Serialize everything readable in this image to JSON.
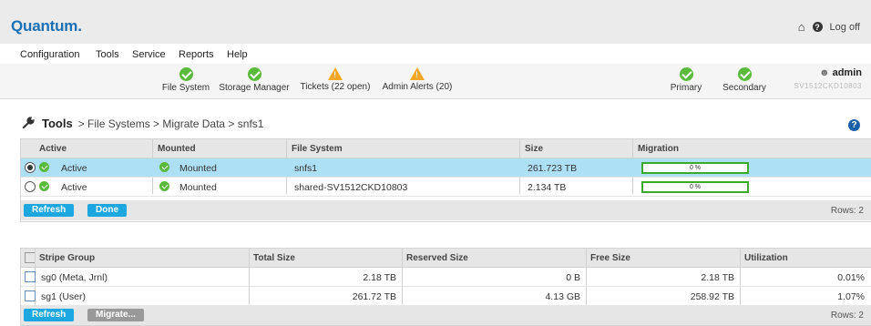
{
  "header": {
    "logo": "Quantum",
    "logo_dot": ".",
    "logoff": "Log off"
  },
  "menu": [
    "Configuration",
    "Tools",
    "Service",
    "Reports",
    "Help"
  ],
  "status": {
    "file_system": "File System",
    "storage_manager": "Storage Manager",
    "tickets": "Tickets (22 open)",
    "admin_alerts": "Admin Alerts (20)",
    "primary": "Primary",
    "secondary": "Secondary",
    "user": "admin",
    "host": "SV1512CKD10803"
  },
  "page": {
    "title": "Tools",
    "breadcrumb": "> File Systems > Migrate Data > snfs1"
  },
  "fs_table": {
    "headers": [
      "Active",
      "Mounted",
      "File System",
      "Size",
      "Migration"
    ],
    "rows": [
      {
        "active": "Active",
        "mounted": "Mounted",
        "fs": "snfs1",
        "size": "261.723 TB",
        "migration": "0 %",
        "progress": 0,
        "selected": true
      },
      {
        "active": "Active",
        "mounted": "Mounted",
        "fs": "shared-SV1512CKD10803",
        "size": "2.134 TB",
        "migration": "0 %",
        "progress": 0,
        "selected": false
      }
    ],
    "refresh": "Refresh",
    "done": "Done",
    "rows_label": "Rows: 2"
  },
  "sg_table": {
    "headers": [
      "Stripe Group",
      "Total Size",
      "Reserved Size",
      "Free Size",
      "Utilization"
    ],
    "rows": [
      {
        "name": "sg0 (Meta, Jrnl)",
        "total": "2.18 TB",
        "reserved": "0 B",
        "free": "2.18 TB",
        "util": "0.01%"
      },
      {
        "name": "sg1 (User)",
        "total": "261.72 TB",
        "reserved": "4.13 GB",
        "free": "258.92 TB",
        "util": "1.07%"
      }
    ],
    "refresh": "Refresh",
    "migrate": "Migrate...",
    "rows_label": "Rows: 2"
  },
  "colors": {
    "accent": "#1ca7e0",
    "selected_row": "#aee0f5",
    "ok": "#5aba3c",
    "warn": "#f5a623",
    "brand": "#1b6fb5"
  }
}
